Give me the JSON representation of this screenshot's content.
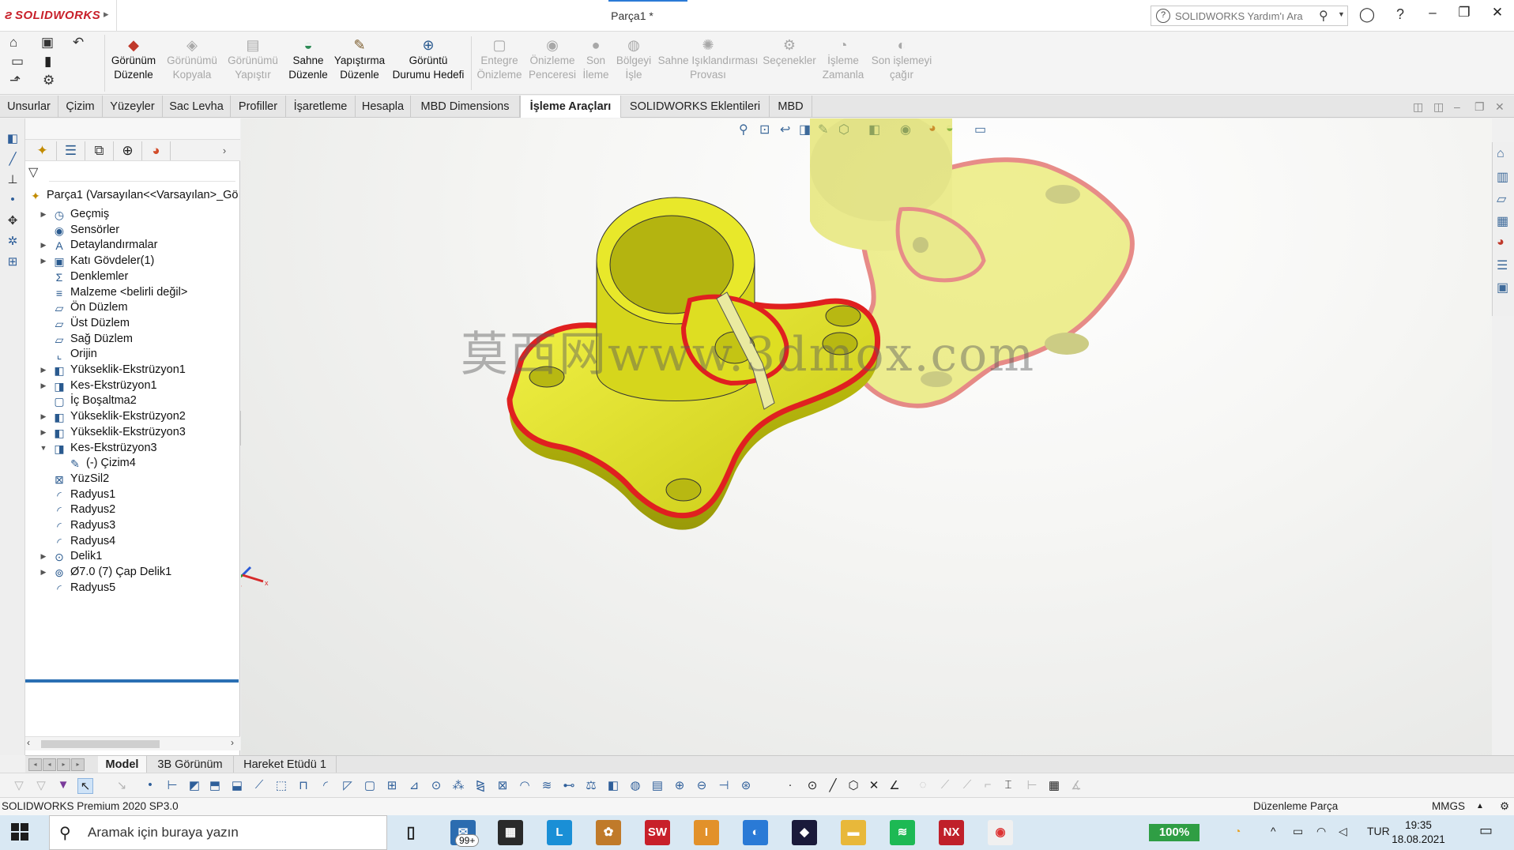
{
  "app": {
    "logo": "SOLIDWORKS",
    "doc_title": "Parça1 *",
    "search_placeholder": "SOLIDWORKS Yardım'ı Ara"
  },
  "commands": [
    {
      "line1": "Görünüm",
      "line2": "Düzenle",
      "enabled": true,
      "icon": "palette-icon"
    },
    {
      "line1": "Görünümü",
      "line2": "Kopyala",
      "enabled": false,
      "icon": "copy-appearance-icon"
    },
    {
      "line1": "Görünümü",
      "line2": "Yapıştır",
      "enabled": false,
      "icon": "paste-appearance-icon"
    },
    {
      "line1": "Sahne",
      "line2": "Düzenle",
      "enabled": true,
      "icon": "scene-icon"
    },
    {
      "line1": "Yapıştırma",
      "line2": "Düzenle",
      "enabled": true,
      "icon": "decal-icon"
    },
    {
      "line1": "Görüntü",
      "line2": "Durumu Hedefi",
      "enabled": true,
      "icon": "target-icon"
    },
    {
      "line1": "Entegre",
      "line2": "Önizleme",
      "enabled": false,
      "icon": "preview-icon"
    },
    {
      "line1": "Önizleme",
      "line2": "Penceresi",
      "enabled": false,
      "icon": "preview-window-icon"
    },
    {
      "line1": "Son",
      "line2": "İleme",
      "enabled": false,
      "icon": "final-render-icon"
    },
    {
      "line1": "Bölgeyi",
      "line2": "İşle",
      "enabled": false,
      "icon": "render-region-icon"
    },
    {
      "line1": "Sahne Işıklandırması",
      "line2": "Provası",
      "enabled": false,
      "icon": "lighting-icon"
    },
    {
      "line1": "Seçenekler",
      "line2": "",
      "enabled": false,
      "icon": "options-icon"
    },
    {
      "line1": "İşleme",
      "line2": "Zamanla",
      "enabled": false,
      "icon": "schedule-icon"
    },
    {
      "line1": "Son işlemeyi",
      "line2": "çağır",
      "enabled": false,
      "icon": "recall-icon"
    }
  ],
  "tabs": [
    "Unsurlar",
    "Çizim",
    "Yüzeyler",
    "Sac Levha",
    "Profiller",
    "İşaretleme",
    "Hesapla",
    "MBD Dimensions",
    "İşleme Araçları",
    "SOLIDWORKS Eklentileri",
    "MBD"
  ],
  "active_tab": "İşleme Araçları",
  "tree": {
    "root": "Parça1  (Varsayılan<<Varsayılan>_Gö",
    "items": [
      {
        "label": "Geçmiş",
        "expandable": true,
        "icon": "history-icon"
      },
      {
        "label": "Sensörler",
        "expandable": false,
        "icon": "sensor-icon"
      },
      {
        "label": "Detaylandırmalar",
        "expandable": true,
        "icon": "annotation-icon"
      },
      {
        "label": "Katı Gövdeler(1)",
        "expandable": true,
        "icon": "solid-body-icon"
      },
      {
        "label": "Denklemler",
        "expandable": false,
        "icon": "equation-icon"
      },
      {
        "label": "Malzeme <belirli değil>",
        "expandable": false,
        "icon": "material-icon"
      },
      {
        "label": "Ön Düzlem",
        "expandable": false,
        "icon": "plane-icon"
      },
      {
        "label": "Üst Düzlem",
        "expandable": false,
        "icon": "plane-icon"
      },
      {
        "label": "Sağ Düzlem",
        "expandable": false,
        "icon": "plane-icon"
      },
      {
        "label": "Orijin",
        "expandable": false,
        "icon": "origin-icon"
      },
      {
        "label": "Yükseklik-Ekstrüzyon1",
        "expandable": true,
        "icon": "extrude-icon"
      },
      {
        "label": "Kes-Ekstrüzyon1",
        "expandable": true,
        "icon": "cut-extrude-icon"
      },
      {
        "label": "İç Boşaltma2",
        "expandable": false,
        "icon": "shell-icon"
      },
      {
        "label": "Yükseklik-Ekstrüzyon2",
        "expandable": true,
        "icon": "extrude-icon"
      },
      {
        "label": "Yükseklik-Ekstrüzyon3",
        "expandable": true,
        "icon": "extrude-icon"
      },
      {
        "label": "Kes-Ekstrüzyon3",
        "expandable": true,
        "expanded": true,
        "icon": "cut-extrude-icon"
      },
      {
        "label": "(-) Çizim4",
        "expandable": false,
        "indent": true,
        "icon": "sketch-icon"
      },
      {
        "label": "YüzSil2",
        "expandable": false,
        "icon": "delete-face-icon"
      },
      {
        "label": "Radyus1",
        "expandable": false,
        "icon": "fillet-icon"
      },
      {
        "label": "Radyus2",
        "expandable": false,
        "icon": "fillet-icon"
      },
      {
        "label": "Radyus3",
        "expandable": false,
        "icon": "fillet-icon"
      },
      {
        "label": "Radyus4",
        "expandable": false,
        "icon": "fillet-icon"
      },
      {
        "label": "Delik1",
        "expandable": true,
        "icon": "hole-icon"
      },
      {
        "label": "Ø7.0 (7) Çap Delik1",
        "expandable": true,
        "icon": "hole-wizard-icon"
      },
      {
        "label": "Radyus5",
        "expandable": false,
        "icon": "fillet-icon"
      }
    ]
  },
  "watermark": "莫西网www.3dmox.com",
  "model_tabs": [
    "Model",
    "3B Görünüm",
    "Hareket Etüdü 1"
  ],
  "active_model_tab": "Model",
  "status": {
    "left": "SOLIDWORKS Premium 2020 SP3.0",
    "mode": "Düzenleme Parça",
    "units": "MMGS"
  },
  "taskbar": {
    "search_placeholder": "Aramak için buraya yazın",
    "mail_badge": "99+",
    "battery": "100%",
    "language": "TUR",
    "time": "19:35",
    "date": "18.08.2021"
  },
  "colors": {
    "part_yellow": "#e3e31a",
    "fillet_red": "#e02020",
    "accent_blue": "#2a6fb3",
    "brand_red": "#c8202a"
  }
}
